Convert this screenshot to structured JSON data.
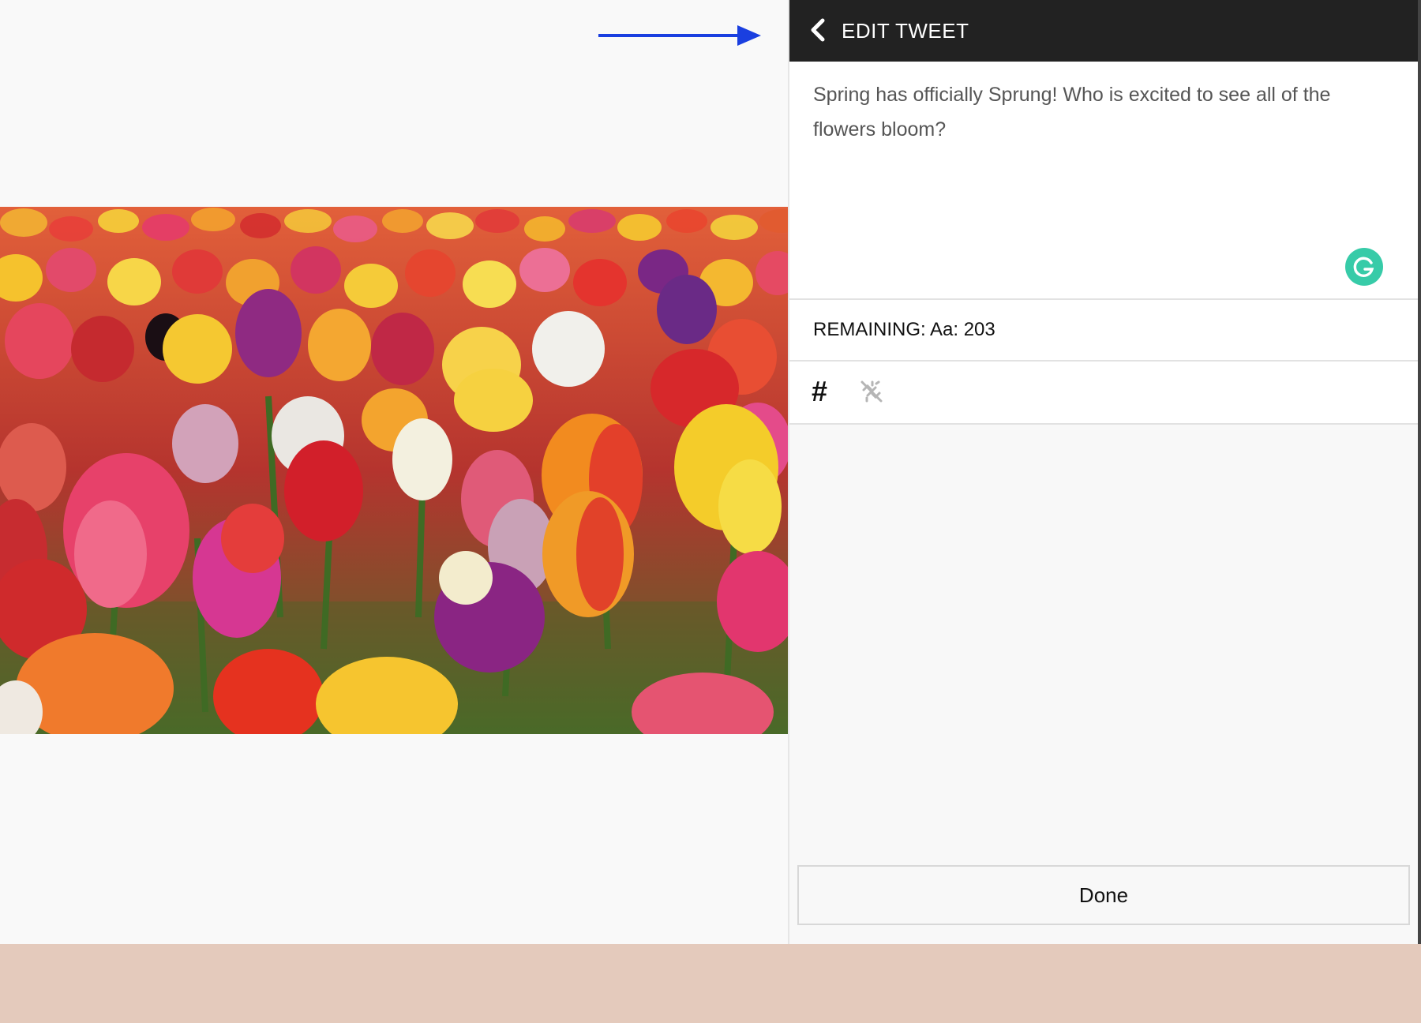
{
  "header": {
    "title": "EDIT TWEET",
    "back_icon": "chevron-left-icon"
  },
  "tweet": {
    "text": "Spring has officially Sprung! Who is excited to see all of the flowers bloom?"
  },
  "grammarly_icon": "grammarly-icon",
  "remaining": {
    "text": "REMAINING: Aa: 203"
  },
  "tools": {
    "hashtag_label": "#",
    "link_icon": "unlink-icon"
  },
  "done_label": "Done",
  "colors": {
    "header_bg": "#222222",
    "arrow": "#1a3fe0",
    "grammarly": "#15c39a",
    "bottom_band": "#e4cabc"
  }
}
